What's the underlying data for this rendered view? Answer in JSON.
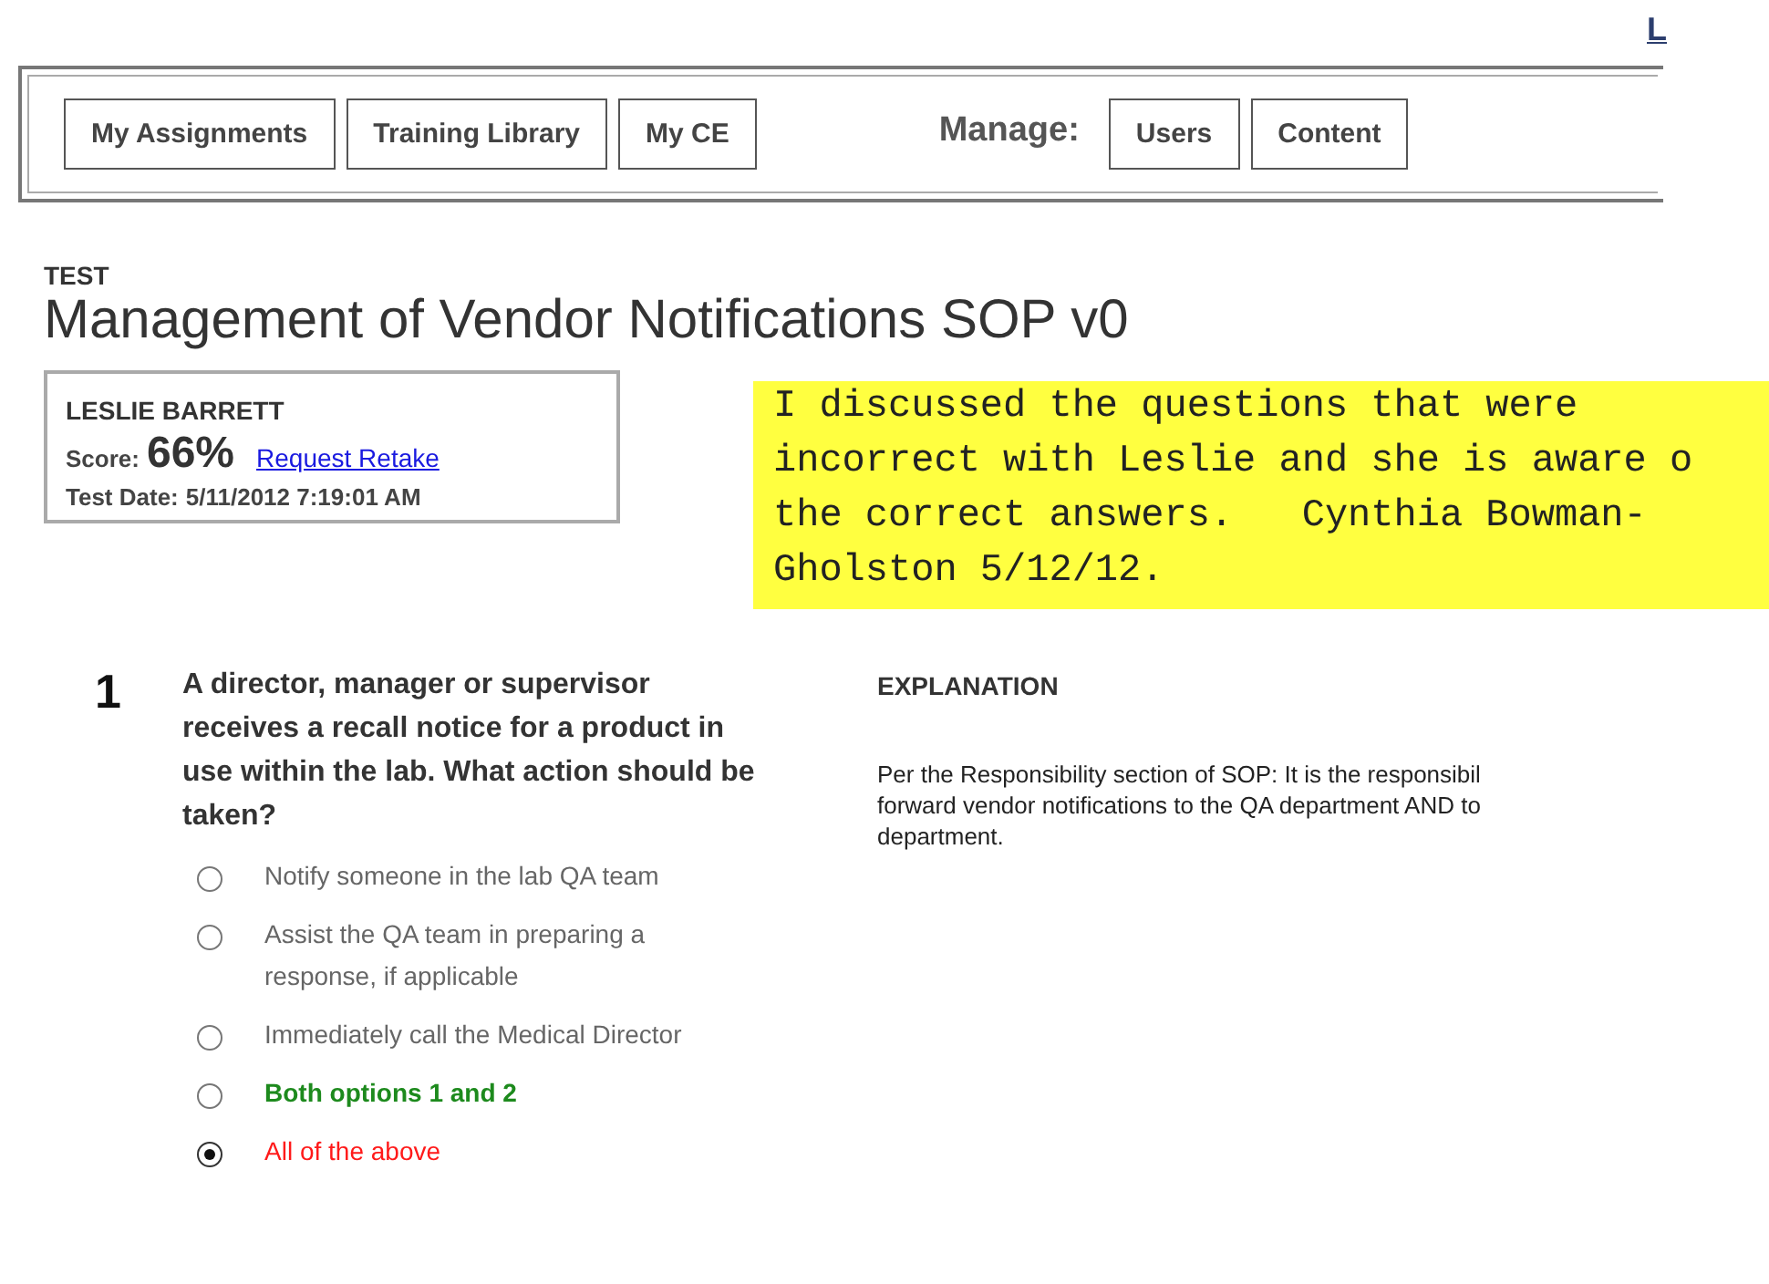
{
  "top_link": "L",
  "nav": {
    "buttons": [
      {
        "label": "My Assignments"
      },
      {
        "label": "Training Library"
      },
      {
        "label": "My CE"
      }
    ],
    "manage_label": "Manage:",
    "manage_buttons": [
      {
        "label": "Users"
      },
      {
        "label": "Content"
      }
    ]
  },
  "heading": {
    "kind_label": "TEST",
    "title": "Management of Vendor Notifications SOP v0"
  },
  "result": {
    "name": "LESLIE BARRETT",
    "score_label": "Score:",
    "score": "66%",
    "retake_link": "Request Retake",
    "date_label": "Test Date:",
    "date": "5/11/2012 7:19:01 AM"
  },
  "note": {
    "lines": [
      "I discussed the questions that were",
      "incorrect with Leslie and she is aware o",
      "the correct answers.   Cynthia Bowman-",
      "Gholston 5/12/12."
    ]
  },
  "question": {
    "number": "1",
    "text": "A director, manager or supervisor receives a recall notice for a product in use within the lab. What action should be taken?",
    "options": [
      {
        "label": "Notify someone in the lab QA team",
        "kind": "plain",
        "selected": false
      },
      {
        "label": "Assist the QA team in preparing a response, if applicable",
        "kind": "plain",
        "selected": false
      },
      {
        "label": "Immediately call the Medical Director",
        "kind": "plain",
        "selected": false
      },
      {
        "label": "Both options 1 and 2",
        "kind": "correct",
        "selected": false
      },
      {
        "label": "All of the above",
        "kind": "wrong",
        "selected": true
      }
    ]
  },
  "explanation": {
    "heading": "EXPLANATION",
    "lines": [
      "Per the Responsibility section of SOP: It is the responsibil",
      "forward vendor notifications to the QA department AND to",
      "department."
    ]
  }
}
